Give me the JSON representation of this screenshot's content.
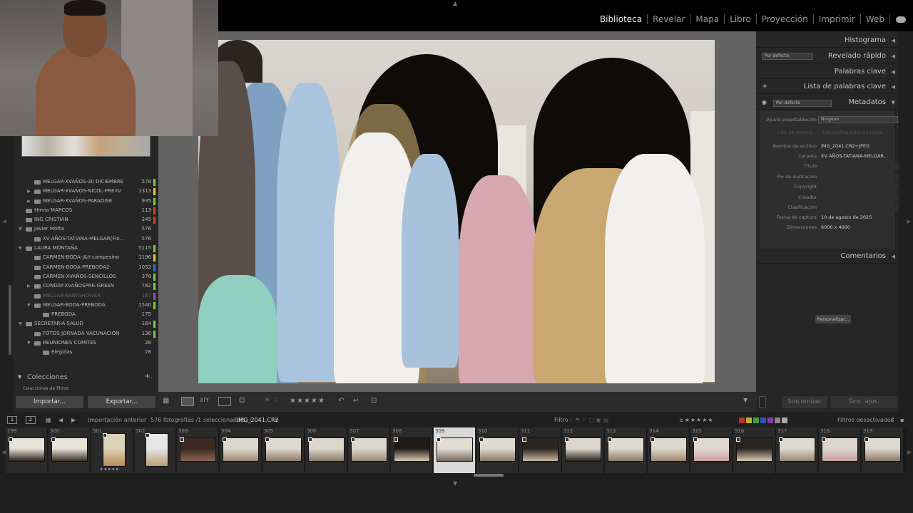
{
  "modules": [
    "Biblioteca",
    "Revelar",
    "Mapa",
    "Libro",
    "Proyección",
    "Imprimir",
    "Web"
  ],
  "active_module": "Biblioteca",
  "folders": [
    {
      "name": "MELGAR-XVAÑOS-30 DICIEMBRE",
      "count": "578",
      "color": "#7bd13d",
      "indent": 2,
      "tri": "",
      "dim": false
    },
    {
      "name": "MELGAR-XVAÑOS-NICOL-PREXV",
      "count": "1313",
      "color": "#e0d43a",
      "indent": 2,
      "tri": "▶",
      "dim": false
    },
    {
      "name": "MELGAR-XVAÑOS-PARADISE",
      "count": "935",
      "color": "#7bd13d",
      "indent": 2,
      "tri": "▶",
      "dim": false
    },
    {
      "name": "Hmna MARCOS",
      "count": "113",
      "color": "#e03a3a",
      "indent": 1,
      "tri": "",
      "dim": false
    },
    {
      "name": "ING CRISTIAN",
      "count": "245",
      "color": "#e03a3a",
      "indent": 1,
      "tri": "",
      "dim": false
    },
    {
      "name": "Javier Motta",
      "count": "576",
      "color": "",
      "indent": 1,
      "tri": "▼",
      "dim": false
    },
    {
      "name": "XV AÑOS-TATIANA-MELGAR(Flo...",
      "count": "576",
      "color": "",
      "indent": 2,
      "tri": "",
      "dim": false
    },
    {
      "name": "LAURA MONTAÑA",
      "count": "5115",
      "color": "#7bd13d",
      "indent": 1,
      "tri": "▼",
      "dim": false
    },
    {
      "name": "CARMEN-BODA-J&Y-campesino",
      "count": "1196",
      "color": "#e0d43a",
      "indent": 2,
      "tri": "",
      "dim": false
    },
    {
      "name": "CARMEN-BODA-PREBODA2",
      "count": "1052",
      "color": "#3a6ee0",
      "indent": 2,
      "tri": "",
      "dim": false
    },
    {
      "name": "CARMEN-XVAÑOS-SENCILLOS",
      "count": "378",
      "color": "#7bd13d",
      "indent": 2,
      "tri": "",
      "dim": false
    },
    {
      "name": "CUNDAY-XVAÑOSPRE-GREEN",
      "count": "782",
      "color": "#7bd13d",
      "indent": 2,
      "tri": "▶",
      "dim": false
    },
    {
      "name": "MELGAR-BABYSHOWER",
      "count": "167",
      "color": "#a04ad8",
      "indent": 2,
      "tri": "",
      "dim": true
    },
    {
      "name": "MELGAR-BODA-PREBODA",
      "count": "1540",
      "color": "#7bd13d",
      "indent": 2,
      "tri": "▼",
      "dim": false
    },
    {
      "name": "PREBODA",
      "count": "175",
      "color": "",
      "indent": 3,
      "tri": "",
      "dim": false
    },
    {
      "name": "SECRETARIA SALUD",
      "count": "164",
      "color": "#7bd13d",
      "indent": 1,
      "tri": "▼",
      "dim": false
    },
    {
      "name": "FOTOS JORNADA VACUNACION",
      "count": "136",
      "color": "#7bd13d",
      "indent": 2,
      "tri": "",
      "dim": false
    },
    {
      "name": "REUNIONES COMITES",
      "count": "28",
      "color": "",
      "indent": 2,
      "tri": "▼",
      "dim": false
    },
    {
      "name": "Elegidas",
      "count": "28",
      "color": "",
      "indent": 3,
      "tri": "",
      "dim": false
    }
  ],
  "collections": {
    "label": "Colecciones",
    "smart": "Colecciones de filtros"
  },
  "buttons": {
    "import": "Importar...",
    "export": "Exportar...",
    "sync": "Sincronizar",
    "sync_settings": "Sinc. ajus."
  },
  "right_panel": {
    "histogram": "Histograma",
    "quick_develop": "Revelado rápido",
    "quick_develop_preset": "Por defecto",
    "keywords": "Palabras clave",
    "keyword_list": "Lista de palabras clave",
    "metadata": "Metadatos",
    "metadata_preset": "Por defecto",
    "comments": "Comentarios",
    "preset_label": "Ajuste preestablecido",
    "preset_value": "Ninguno",
    "target_photo": "Foto de destino",
    "selected_photos": "Fotografías seleccionadas",
    "customize": "Personalizar..."
  },
  "metadata": [
    {
      "k": "Nombre de archivo",
      "v": "IMG_2041.CR2+JPEG"
    },
    {
      "k": "Carpeta",
      "v": "XV AÑOS-TATIANA-MELGAR..."
    },
    {
      "k": "Título",
      "v": ""
    },
    {
      "k": "Pie de ilustración",
      "v": ""
    },
    {
      "k": "Copyright",
      "v": ""
    },
    {
      "k": "Creador",
      "v": ""
    },
    {
      "k": "Clasificación",
      "v": ""
    },
    {
      "k": "Fecha de captura",
      "v": "10 de agosto de 2025"
    },
    {
      "k": "Dimensiones",
      "v": "6000 x 4000"
    }
  ],
  "film_bar": {
    "page1": "1",
    "page2": "2",
    "source": "Importación anterior",
    "info": "576 fotografías /1 seleccionada(s) /",
    "filename": "IMG_2041.CR2",
    "filter_label": "Filtro :",
    "filters_off": "Filtros desactivados"
  },
  "filmstrip": [
    {
      "n": "299",
      "tall": false,
      "c1": "#e8e2d8",
      "c2": "#2a221b"
    },
    {
      "n": "300",
      "tall": false,
      "c1": "#e8e2d8",
      "c2": "#3b3026"
    },
    {
      "n": "301",
      "tall": true,
      "c1": "#ddd3b8",
      "c2": "#b88a50",
      "stars": "★★★★★"
    },
    {
      "n": "302",
      "tall": true,
      "c1": "#e6e6e6",
      "c2": "#b8a078"
    },
    {
      "n": "303",
      "tall": false,
      "c1": "#3a2a22",
      "c2": "#8a6450"
    },
    {
      "n": "304",
      "tall": false,
      "c1": "#ddd6cc",
      "c2": "#a08870"
    },
    {
      "n": "305",
      "tall": false,
      "c1": "#e0d9cf",
      "c2": "#8c7a6a"
    },
    {
      "n": "306",
      "tall": false,
      "c1": "#ddd6cc",
      "c2": "#8a7868"
    },
    {
      "n": "307",
      "tall": false,
      "c1": "#ddd6cc",
      "c2": "#9a8878"
    },
    {
      "n": "308",
      "tall": false,
      "c1": "#1f1a16",
      "c2": "#d8c8b0"
    },
    {
      "n": "309",
      "tall": false,
      "c1": "#e2dcd3",
      "c2": "#7a6a5e",
      "selected": true
    },
    {
      "n": "310",
      "tall": false,
      "c1": "#e0d9cf",
      "c2": "#8c7a6a"
    },
    {
      "n": "311",
      "tall": false,
      "c1": "#2a241f",
      "c2": "#c9b6a0"
    },
    {
      "n": "312",
      "tall": false,
      "c1": "#ddd6cc",
      "c2": "#2a221b"
    },
    {
      "n": "313",
      "tall": false,
      "c1": "#e0d9cf",
      "c2": "#8c7a6a"
    },
    {
      "n": "314",
      "tall": false,
      "c1": "#ddd6cc",
      "c2": "#a08870"
    },
    {
      "n": "315",
      "tall": false,
      "c1": "#e0d9cf",
      "c2": "#c8a0a0"
    },
    {
      "n": "316",
      "tall": false,
      "c1": "#2a241f",
      "c2": "#d8c8b0"
    },
    {
      "n": "317",
      "tall": false,
      "c1": "#e0d9cf",
      "c2": "#9a8878"
    },
    {
      "n": "318",
      "tall": false,
      "c1": "#ddd6cc",
      "c2": "#c8a0a0"
    },
    {
      "n": "319",
      "tall": false,
      "c1": "#e0d9cf",
      "c2": "#8c7a6a"
    }
  ],
  "colors": {
    "accent": "#f0f0f0",
    "panel": "#262626",
    "background": "#636363"
  }
}
